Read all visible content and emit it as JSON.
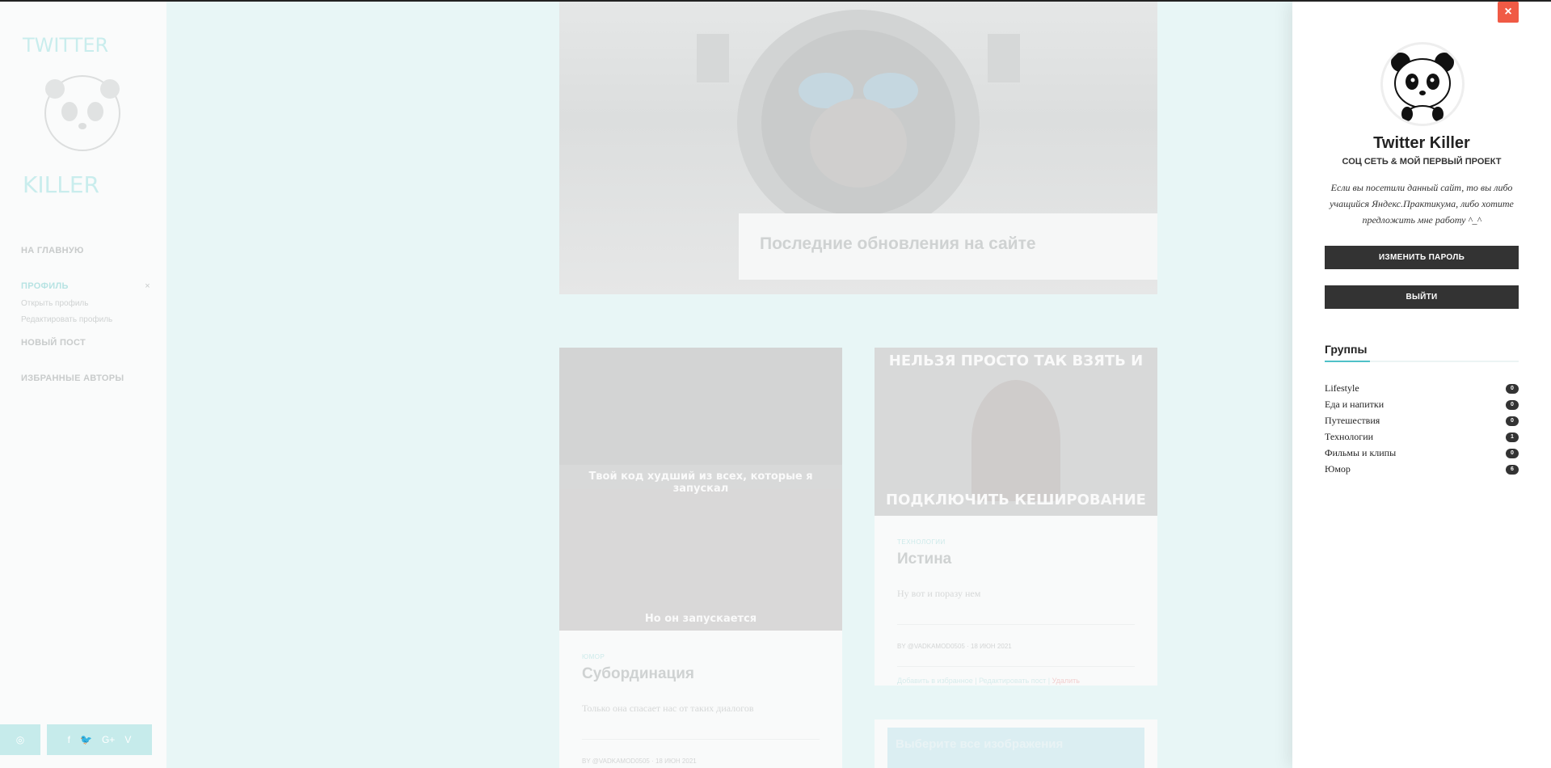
{
  "sidebar": {
    "logo_text_top": "TWITTER",
    "logo_text_bottom": "KILLER",
    "nav": {
      "home": "НА ГЛАВНУЮ",
      "profile": "ПРОФИЛЬ",
      "profile_close": "×",
      "open_profile": "Открыть профиль",
      "edit_profile": "Редактировать профиль",
      "new_post": "НОВЫЙ ПОСТ",
      "favorites": "ИЗБРАННЫЕ АВТОРЫ"
    },
    "social": {
      "instagram": "◎",
      "facebook": "f",
      "twitter": "🐦",
      "google": "G+",
      "vk": "V"
    }
  },
  "main": {
    "hero_caption": "Последние обновления на сайте",
    "posts": [
      {
        "meme_top": "Твой код худший из всех, которые я запускал",
        "meme_bottom": "Но он запускается",
        "category": "ЮМОР",
        "title": "Субординация",
        "text": "Только она спасает нас от таких диалогов",
        "meta": "BY @VADKAMOD0505 · 18 ИЮН 2021"
      },
      {
        "meme_top": "НЕЛЬЗЯ ПРОСТО ТАК ВЗЯТЬ И",
        "meme_bottom": "ПОДКЛЮЧИТЬ КЕШИРОВАНИЕ",
        "category": "ТЕХНОЛОГИИ",
        "title": "Истина",
        "text": "Ну вот и поразу нем",
        "meta": "BY @VADKAMOD0505 · 18 ИЮН 2021",
        "links": "Добавить в избранное | Редактировать пост |",
        "links_red": "Удалить"
      },
      {
        "banner": "Выберите все изображения"
      }
    ]
  },
  "panel": {
    "close": "×",
    "site_name": "Twitter Killer",
    "tagline": "СОЦ СЕТЬ & МОЙ ПЕРВЫЙ ПРОЕКТ",
    "description": "Если вы посетили данный сайт, то вы либо учащийся Яндекс.Практикума, либо хотите предложить мне работу ^_^",
    "change_password": "ИЗМЕНИТЬ ПАРОЛЬ",
    "logout": "ВЫЙТИ",
    "groups_title": "Группы",
    "groups": [
      {
        "name": "Lifestyle",
        "count": "0"
      },
      {
        "name": "Еда и напитки",
        "count": "0"
      },
      {
        "name": "Путешествия",
        "count": "0"
      },
      {
        "name": "Технологии",
        "count": "1"
      },
      {
        "name": "Фильмы и клипы",
        "count": "0"
      },
      {
        "name": "Юмор",
        "count": "6"
      }
    ]
  },
  "colors": {
    "accent": "#4fc1c8",
    "close_button": "#f05a45",
    "dark_button": "#333333"
  }
}
